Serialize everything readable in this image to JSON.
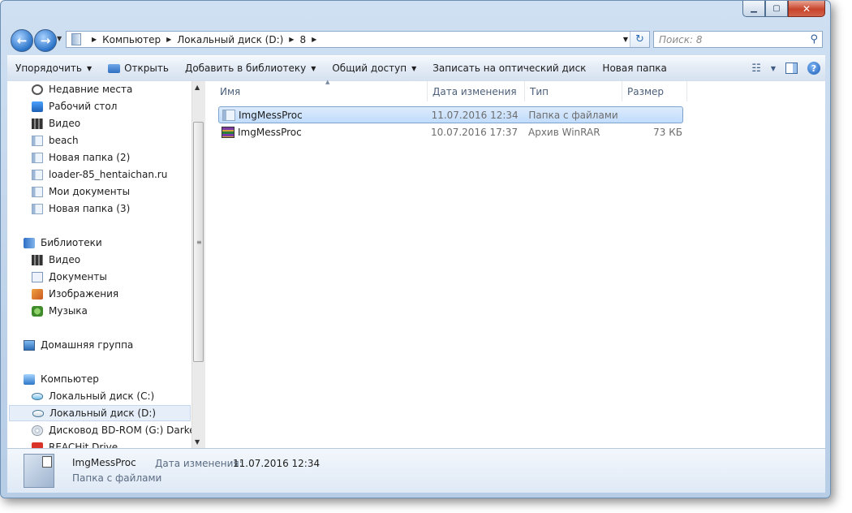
{
  "window": {
    "caption": {
      "minimize": "▁",
      "maximize": "▢",
      "close": "✕"
    }
  },
  "address": {
    "crumbs": [
      "Компьютер",
      "Локальный диск (D:)",
      "8"
    ]
  },
  "search": {
    "placeholder": "Поиск: 8"
  },
  "toolbar": {
    "organize": "Упорядочить",
    "open": "Открыть",
    "add_to_library": "Добавить в библиотеку",
    "share": "Общий доступ",
    "burn": "Записать на оптический диск",
    "new_folder": "Новая папка"
  },
  "nav": {
    "favorites": [
      "Недавние места",
      "Рабочий стол",
      "Видео",
      "beach",
      "Новая папка (2)",
      "loader-85_hentaichan.ru",
      "Мои документы",
      "Новая папка (3)"
    ],
    "libraries_label": "Библиотеки",
    "libraries": [
      "Видео",
      "Документы",
      "Изображения",
      "Музыка"
    ],
    "homegroup": "Домашняя группа",
    "computer_label": "Компьютер",
    "computer": [
      "Локальный диск (C:)",
      "Локальный диск (D:)",
      "Дисковод BD-ROM (G:) Darkest D",
      "REACHit Drive"
    ],
    "selected": "Локальный диск (D:)"
  },
  "columns": {
    "name": "Имя",
    "date": "Дата изменения",
    "type": "Тип",
    "size": "Размер"
  },
  "files": [
    {
      "name": "ImgMessProc",
      "date": "11.07.2016 12:34",
      "type": "Папка с файлами",
      "size": "",
      "icon": "folder-icon",
      "selected": true
    },
    {
      "name": "ImgMessProc",
      "date": "10.07.2016 17:37",
      "type": "Архив WinRAR",
      "size": "73 КБ",
      "icon": "rar-archive-icon",
      "selected": false
    }
  ],
  "details": {
    "name": "ImgMessProc",
    "date_label": "Дата изменения:",
    "date": "11.07.2016 12:34",
    "type": "Папка с файлами"
  }
}
